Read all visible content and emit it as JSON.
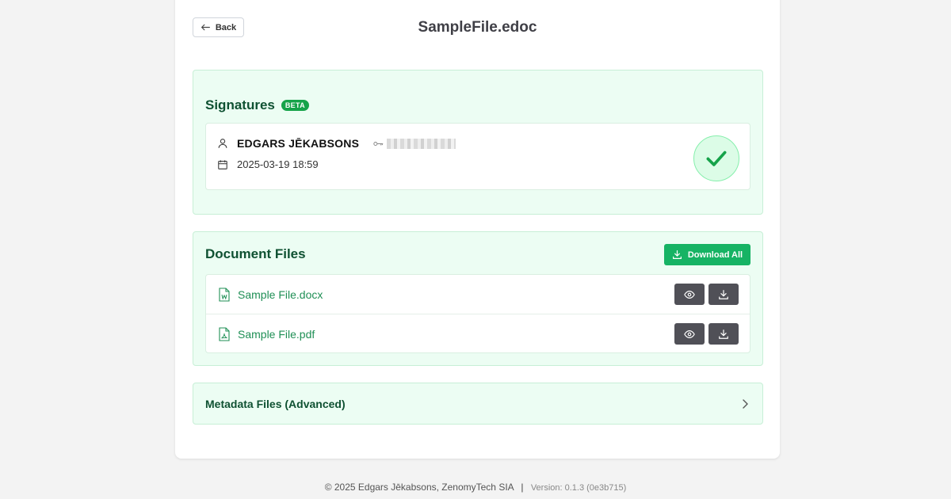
{
  "header": {
    "back_label": "Back",
    "title": "SampleFile.edoc"
  },
  "signatures": {
    "heading": "Signatures",
    "badge": "BETA",
    "signer": {
      "name": "EDGARS JĒKABSONS",
      "date": "2025-03-19 18:59",
      "status": "valid"
    }
  },
  "documents": {
    "heading": "Document Files",
    "download_all_label": "Download All",
    "files": [
      {
        "name": "Sample File.docx",
        "type": "word-file-icon"
      },
      {
        "name": "Sample File.pdf",
        "type": "pdf-file-icon"
      }
    ]
  },
  "metadata": {
    "heading": "Metadata Files (Advanced)"
  },
  "footer": {
    "copyright": "© 2025 Edgars Jēkabsons, ZenomyTech SIA",
    "separator": "|",
    "version": "Version: 0.1.3 (0e3b715)"
  },
  "colors": {
    "accent": "#16b364",
    "panel_bg": "#ecfdf3",
    "heading": "#0f5132",
    "icon_button": "#505057"
  }
}
